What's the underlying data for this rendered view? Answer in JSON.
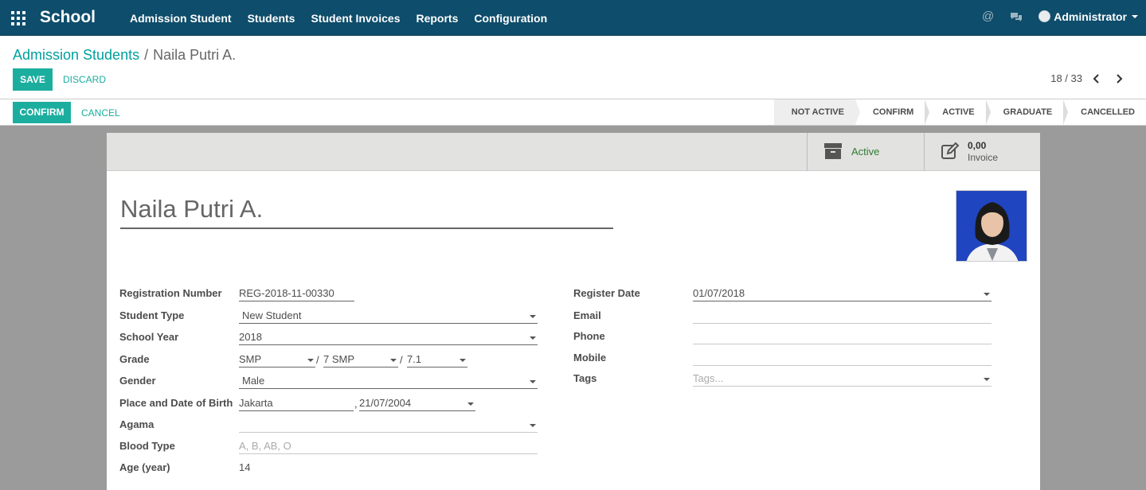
{
  "navbar": {
    "brand": "School",
    "menu": [
      "Admission Student",
      "Students",
      "Student Invoices",
      "Reports",
      "Configuration"
    ],
    "user": "Administrator"
  },
  "breadcrumb": {
    "parent": "Admission Students",
    "separator": "/",
    "current": "Naila Putri A."
  },
  "actions": {
    "save": "SAVE",
    "discard": "DISCARD"
  },
  "pager": {
    "text": "18 / 33"
  },
  "statusbar": {
    "confirm": "CONFIRM",
    "cancel": "CANCEL",
    "stages": [
      "NOT ACTIVE",
      "CONFIRM",
      "ACTIVE",
      "GRADUATE",
      "CANCELLED"
    ],
    "current_stage": "NOT ACTIVE"
  },
  "smart_buttons": {
    "active": "Active",
    "invoice_value": "0,00",
    "invoice_label": "Invoice"
  },
  "record": {
    "name": "Naila Putri A."
  },
  "left_fields": {
    "registration_number": {
      "label": "Registration Number",
      "value": "REG-2018-11-00330"
    },
    "student_type": {
      "label": "Student Type",
      "value": "New Student"
    },
    "school_year": {
      "label": "School Year",
      "value": "2018"
    },
    "grade": {
      "label": "Grade",
      "value1": "SMP",
      "sep1": "/",
      "value2": "7 SMP",
      "sep2": "/",
      "value3": "7.1"
    },
    "gender": {
      "label": "Gender",
      "value": "Male"
    },
    "birth": {
      "label": "Place and Date of Birth",
      "place": "Jakarta",
      "sep": ",",
      "date": "21/07/2004"
    },
    "agama": {
      "label": "Agama",
      "value": ""
    },
    "blood_type": {
      "label": "Blood Type",
      "placeholder": "A, B, AB, O"
    },
    "age": {
      "label": "Age (year)",
      "value": "14"
    }
  },
  "right_fields": {
    "register_date": {
      "label": "Register Date",
      "value": "01/07/2018"
    },
    "email": {
      "label": "Email",
      "value": ""
    },
    "phone": {
      "label": "Phone",
      "value": ""
    },
    "mobile": {
      "label": "Mobile",
      "value": ""
    },
    "tags": {
      "label": "Tags",
      "placeholder": "Tags..."
    }
  },
  "colors": {
    "navbar": "#0e4d6b",
    "accent": "#1bae9f",
    "link": "#00a09d"
  }
}
